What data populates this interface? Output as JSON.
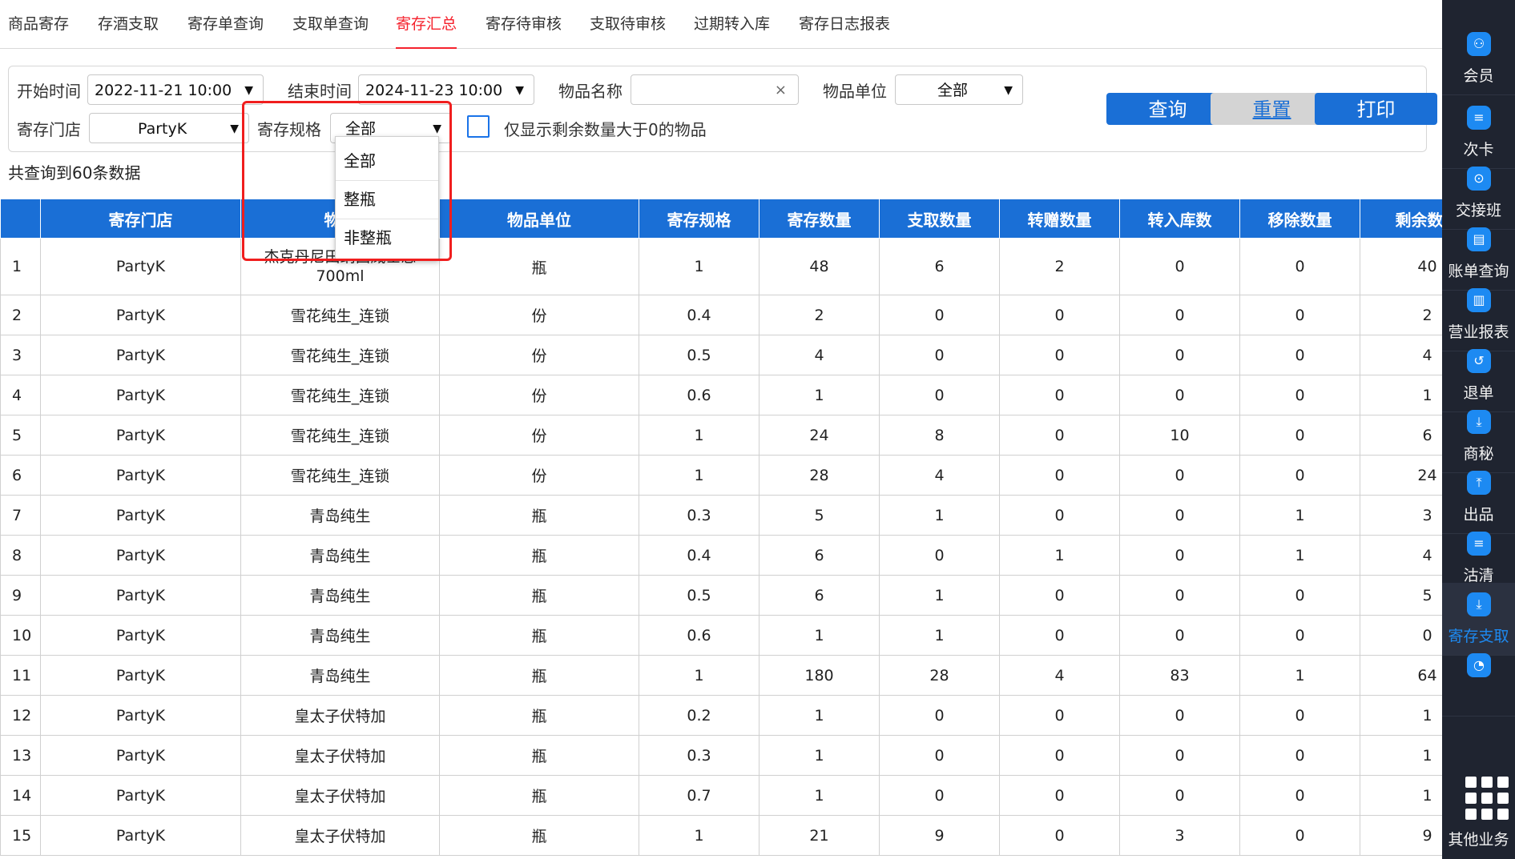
{
  "tabs": [
    {
      "label": "商品寄存",
      "active": false
    },
    {
      "label": "存酒支取",
      "active": false
    },
    {
      "label": "寄存单查询",
      "active": false
    },
    {
      "label": "支取单查询",
      "active": false
    },
    {
      "label": "寄存汇总",
      "active": true
    },
    {
      "label": "寄存待审核",
      "active": false
    },
    {
      "label": "支取待审核",
      "active": false
    },
    {
      "label": "过期转入库",
      "active": false
    },
    {
      "label": "寄存日志报表",
      "active": false
    }
  ],
  "filter": {
    "start_label": "开始时间",
    "start_value": "2022-11-21 10:00",
    "end_label": "结束时间",
    "end_value": "2024-11-23 10:00",
    "item_name_label": "物品名称",
    "item_name_value": "",
    "clear_glyph": "×",
    "unit_label": "物品单位",
    "unit_value": "全部",
    "store_label": "寄存门店",
    "store_value": "PartyK",
    "spec_label": "寄存规格",
    "spec_value": "全部",
    "only_positive_label": "仅显示剩余数量大于0的物品",
    "only_positive_checked": false,
    "caret": "▼"
  },
  "buttons": {
    "query": "查询",
    "reset": "重置",
    "print": "打印"
  },
  "summary": {
    "count_text": "共查询到60条数据"
  },
  "dropdown": {
    "options": [
      "全部",
      "整瓶",
      "非整瓶"
    ]
  },
  "table": {
    "headers": [
      "",
      "寄存门店",
      "物品",
      "物品单位",
      "寄存规格",
      "寄存数量",
      "支取数量",
      "转赠数量",
      "转入库数",
      "移除数量",
      "剩余数量"
    ],
    "rows": [
      [
        "1",
        "PartyK",
        "杰克丹尼田纳西威士忌\n700ml",
        "瓶",
        "1",
        "48",
        "6",
        "2",
        "0",
        "0",
        "40"
      ],
      [
        "2",
        "PartyK",
        "雪花纯生_连锁",
        "份",
        "0.4",
        "2",
        "0",
        "0",
        "0",
        "0",
        "2"
      ],
      [
        "3",
        "PartyK",
        "雪花纯生_连锁",
        "份",
        "0.5",
        "4",
        "0",
        "0",
        "0",
        "0",
        "4"
      ],
      [
        "4",
        "PartyK",
        "雪花纯生_连锁",
        "份",
        "0.6",
        "1",
        "0",
        "0",
        "0",
        "0",
        "1"
      ],
      [
        "5",
        "PartyK",
        "雪花纯生_连锁",
        "份",
        "1",
        "24",
        "8",
        "0",
        "10",
        "0",
        "6"
      ],
      [
        "6",
        "PartyK",
        "雪花纯生_连锁",
        "份",
        "1",
        "28",
        "4",
        "0",
        "0",
        "0",
        "24"
      ],
      [
        "7",
        "PartyK",
        "青岛纯生",
        "瓶",
        "0.3",
        "5",
        "1",
        "0",
        "0",
        "1",
        "3"
      ],
      [
        "8",
        "PartyK",
        "青岛纯生",
        "瓶",
        "0.4",
        "6",
        "0",
        "1",
        "0",
        "1",
        "4"
      ],
      [
        "9",
        "PartyK",
        "青岛纯生",
        "瓶",
        "0.5",
        "6",
        "1",
        "0",
        "0",
        "0",
        "5"
      ],
      [
        "10",
        "PartyK",
        "青岛纯生",
        "瓶",
        "0.6",
        "1",
        "1",
        "0",
        "0",
        "0",
        "0"
      ],
      [
        "11",
        "PartyK",
        "青岛纯生",
        "瓶",
        "1",
        "180",
        "28",
        "4",
        "83",
        "1",
        "64"
      ],
      [
        "12",
        "PartyK",
        "皇太子伏特加",
        "瓶",
        "0.2",
        "1",
        "0",
        "0",
        "0",
        "0",
        "1"
      ],
      [
        "13",
        "PartyK",
        "皇太子伏特加",
        "瓶",
        "0.3",
        "1",
        "0",
        "0",
        "0",
        "0",
        "1"
      ],
      [
        "14",
        "PartyK",
        "皇太子伏特加",
        "瓶",
        "0.7",
        "1",
        "0",
        "0",
        "0",
        "0",
        "1"
      ],
      [
        "15",
        "PartyK",
        "皇太子伏特加",
        "瓶",
        "1",
        "21",
        "9",
        "0",
        "3",
        "0",
        "9"
      ]
    ]
  },
  "sidebar": {
    "items": [
      {
        "label": "会员",
        "icon": "member-icon",
        "glyph": "⚇",
        "active": false
      },
      {
        "label": "次卡",
        "icon": "card-icon",
        "glyph": "≡",
        "active": false
      },
      {
        "label": "交接班",
        "icon": "shift-icon",
        "glyph": "⊙",
        "active": false
      },
      {
        "label": "账单查询",
        "icon": "bill-icon",
        "glyph": "▤",
        "active": false
      },
      {
        "label": "营业报表",
        "icon": "report-icon",
        "glyph": "▥",
        "active": false
      },
      {
        "label": "退单",
        "icon": "refund-icon",
        "glyph": "↺",
        "active": false
      },
      {
        "label": "商秘",
        "icon": "download-icon",
        "glyph": "⤓",
        "active": false
      },
      {
        "label": "出品",
        "icon": "output-icon",
        "glyph": "⤒",
        "active": false
      },
      {
        "label": "沽清",
        "icon": "soldout-icon",
        "glyph": "≡",
        "active": false
      },
      {
        "label": "寄存支取",
        "icon": "deposit-icon",
        "glyph": "⤓",
        "active": true
      },
      {
        "label": "",
        "icon": "pie-chart-icon",
        "glyph": "◔",
        "active": false
      },
      {
        "label": "其他业务",
        "icon": "grid-icon",
        "glyph": "",
        "active": false
      }
    ]
  },
  "colors": {
    "accent": "#1a6fd6",
    "active_tab": "#f5222d",
    "sidebar_bg": "#1f2430",
    "highlight_box": "#f01e1e"
  }
}
